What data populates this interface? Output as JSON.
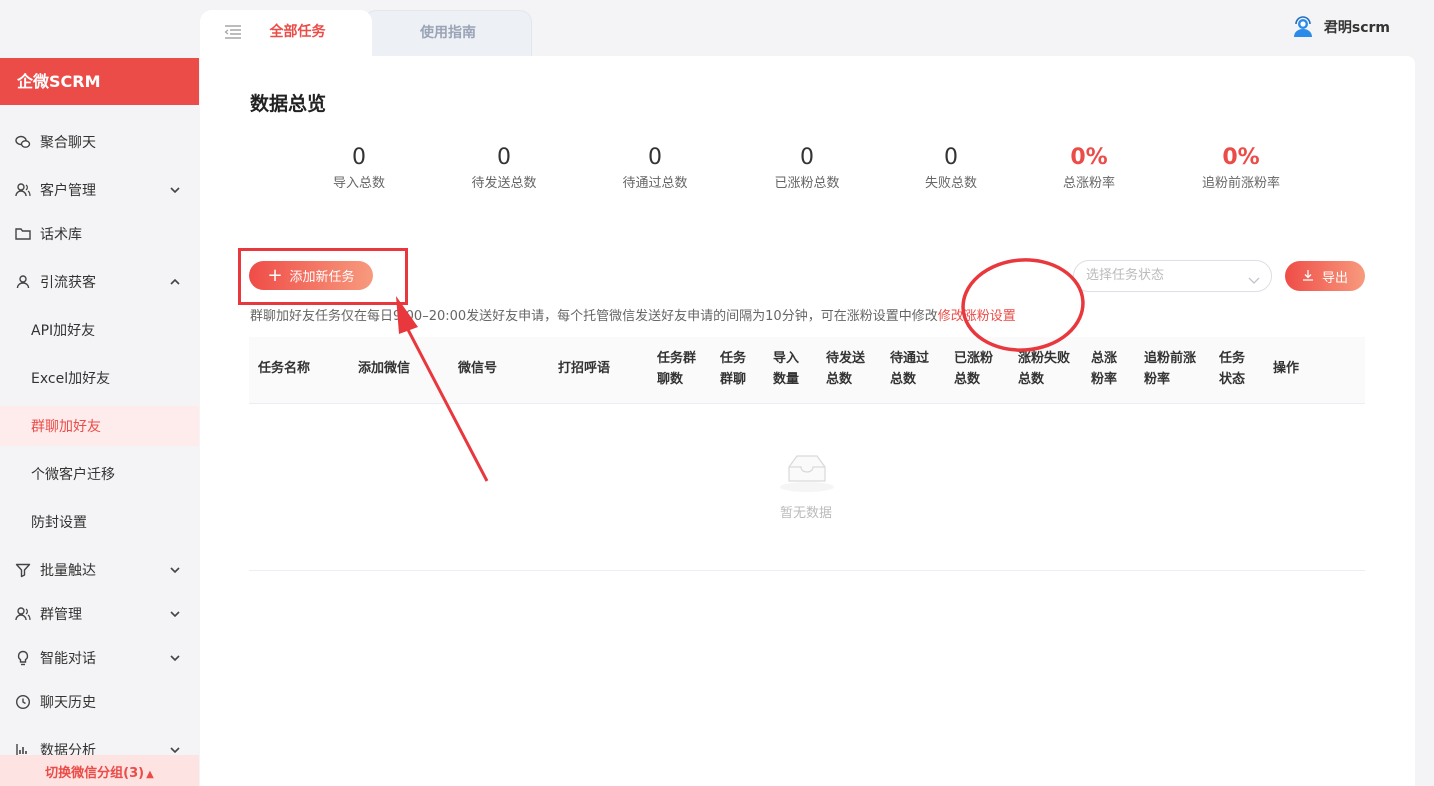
{
  "brand": "企微SCRM",
  "sidebar": {
    "items": [
      {
        "label": "聚合聊天",
        "icon": "wechat-icon",
        "chevron": ""
      },
      {
        "label": "客户管理",
        "icon": "customer-icon",
        "chevron": "down"
      },
      {
        "label": "话术库",
        "icon": "folder-icon",
        "chevron": ""
      },
      {
        "label": "引流获客",
        "icon": "user-icon",
        "chevron": "up"
      },
      {
        "label": "API加好友",
        "sub": true
      },
      {
        "label": "Excel加好友",
        "sub": true
      },
      {
        "label": "群聊加好友",
        "sub": true,
        "active": true
      },
      {
        "label": "个微客户迁移",
        "sub": true
      },
      {
        "label": "防封设置",
        "sub": true
      },
      {
        "label": "批量触达",
        "icon": "filter-icon",
        "chevron": "down"
      },
      {
        "label": "群管理",
        "icon": "group-icon",
        "chevron": "down"
      },
      {
        "label": "智能对话",
        "icon": "bulb-icon",
        "chevron": "down"
      },
      {
        "label": "聊天历史",
        "icon": "clock-icon",
        "chevron": ""
      },
      {
        "label": "数据分析",
        "icon": "chart-icon",
        "chevron": "down"
      }
    ],
    "switch_label": "切换微信分组(3)"
  },
  "tabs": {
    "active": "全部任务",
    "inactive": "使用指南"
  },
  "user": {
    "name": "君明scrm"
  },
  "page_title": "数据总览",
  "stats": [
    {
      "value": "0",
      "label": "导入总数"
    },
    {
      "value": "0",
      "label": "待发送总数"
    },
    {
      "value": "0",
      "label": "待通过总数"
    },
    {
      "value": "0",
      "label": "已涨粉总数"
    },
    {
      "value": "0",
      "label": "失败总数"
    },
    {
      "value": "0%",
      "label": "总涨粉率"
    },
    {
      "value": "0%",
      "label": "追粉前涨粉率"
    }
  ],
  "toolbar": {
    "add_label": "添加新任务",
    "status_placeholder": "选择任务状态",
    "export_label": "导出"
  },
  "notice": {
    "text": "群聊加好友任务仅在每日9:00–20:00发送好友申请，每个托管微信发送好友申请的间隔为10分钟，可在涨粉设置中修改",
    "link": "修改涨粉设置"
  },
  "table": {
    "columns": [
      {
        "l1": "任务名称",
        "l2": ""
      },
      {
        "l1": "添加微信",
        "l2": ""
      },
      {
        "l1": "微信号",
        "l2": ""
      },
      {
        "l1": "打招呼语",
        "l2": ""
      },
      {
        "l1": "任务群",
        "l2": "聊数"
      },
      {
        "l1": "任务",
        "l2": "群聊"
      },
      {
        "l1": "导入",
        "l2": "数量"
      },
      {
        "l1": "待发送",
        "l2": "总数"
      },
      {
        "l1": "待通过",
        "l2": "总数"
      },
      {
        "l1": "已涨粉",
        "l2": "总数"
      },
      {
        "l1": "涨粉失败",
        "l2": "总数"
      },
      {
        "l1": "总涨",
        "l2": "粉率"
      },
      {
        "l1": "追粉前涨",
        "l2": "粉率"
      },
      {
        "l1": "任务",
        "l2": "状态"
      },
      {
        "l1": "操作",
        "l2": ""
      }
    ],
    "empty_text": "暂无数据"
  },
  "colors": {
    "accent": "#ec4c48",
    "annotation": "#e8383d"
  }
}
